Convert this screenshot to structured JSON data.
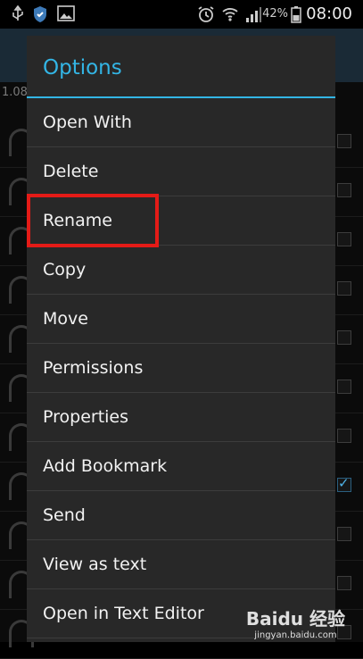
{
  "status_bar": {
    "battery_percent": "42%",
    "time": "08:00",
    "icons": [
      "usb-icon",
      "shield-icon",
      "image-icon",
      "alarm-icon",
      "wifi-icon",
      "signal-icon",
      "battery-icon"
    ]
  },
  "background": {
    "breadcrumb_fragment": "1.08",
    "checked_row_index": 7
  },
  "dialog": {
    "title": "Options",
    "options": [
      "Open With",
      "Delete",
      "Rename",
      "Copy",
      "Move",
      "Permissions",
      "Properties",
      "Add Bookmark",
      "Send",
      "View as text",
      "Open in Text Editor"
    ],
    "highlighted_option": "Rename"
  },
  "watermark": {
    "logo": "Baidu 经验",
    "url": "jingyan.baidu.com"
  },
  "colors": {
    "accent": "#33b5e5",
    "highlight": "#e41b17",
    "dialog_bg": "#282828"
  }
}
